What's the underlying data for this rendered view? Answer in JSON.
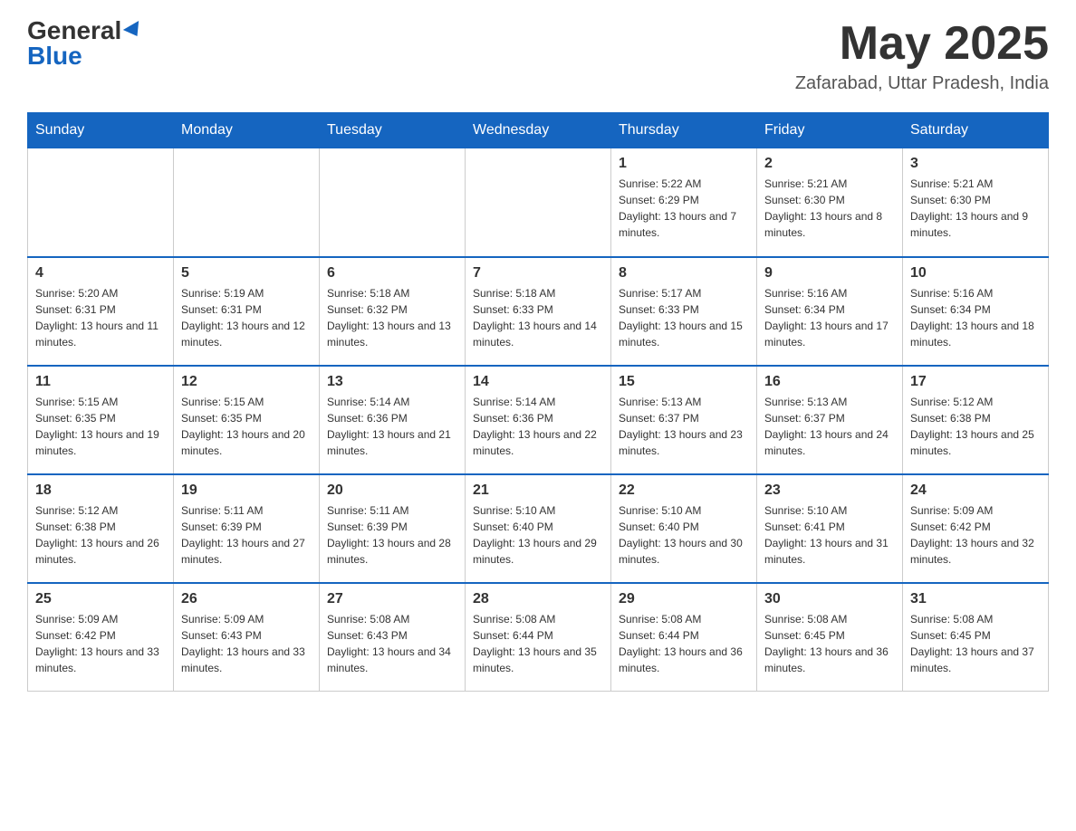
{
  "header": {
    "logo": {
      "general": "General",
      "blue": "Blue"
    },
    "title": "May 2025",
    "subtitle": "Zafarabad, Uttar Pradesh, India"
  },
  "days_of_week": [
    "Sunday",
    "Monday",
    "Tuesday",
    "Wednesday",
    "Thursday",
    "Friday",
    "Saturday"
  ],
  "weeks": [
    {
      "days": [
        {
          "number": "",
          "info": ""
        },
        {
          "number": "",
          "info": ""
        },
        {
          "number": "",
          "info": ""
        },
        {
          "number": "",
          "info": ""
        },
        {
          "number": "1",
          "info": "Sunrise: 5:22 AM\nSunset: 6:29 PM\nDaylight: 13 hours and 7 minutes."
        },
        {
          "number": "2",
          "info": "Sunrise: 5:21 AM\nSunset: 6:30 PM\nDaylight: 13 hours and 8 minutes."
        },
        {
          "number": "3",
          "info": "Sunrise: 5:21 AM\nSunset: 6:30 PM\nDaylight: 13 hours and 9 minutes."
        }
      ]
    },
    {
      "days": [
        {
          "number": "4",
          "info": "Sunrise: 5:20 AM\nSunset: 6:31 PM\nDaylight: 13 hours and 11 minutes."
        },
        {
          "number": "5",
          "info": "Sunrise: 5:19 AM\nSunset: 6:31 PM\nDaylight: 13 hours and 12 minutes."
        },
        {
          "number": "6",
          "info": "Sunrise: 5:18 AM\nSunset: 6:32 PM\nDaylight: 13 hours and 13 minutes."
        },
        {
          "number": "7",
          "info": "Sunrise: 5:18 AM\nSunset: 6:33 PM\nDaylight: 13 hours and 14 minutes."
        },
        {
          "number": "8",
          "info": "Sunrise: 5:17 AM\nSunset: 6:33 PM\nDaylight: 13 hours and 15 minutes."
        },
        {
          "number": "9",
          "info": "Sunrise: 5:16 AM\nSunset: 6:34 PM\nDaylight: 13 hours and 17 minutes."
        },
        {
          "number": "10",
          "info": "Sunrise: 5:16 AM\nSunset: 6:34 PM\nDaylight: 13 hours and 18 minutes."
        }
      ]
    },
    {
      "days": [
        {
          "number": "11",
          "info": "Sunrise: 5:15 AM\nSunset: 6:35 PM\nDaylight: 13 hours and 19 minutes."
        },
        {
          "number": "12",
          "info": "Sunrise: 5:15 AM\nSunset: 6:35 PM\nDaylight: 13 hours and 20 minutes."
        },
        {
          "number": "13",
          "info": "Sunrise: 5:14 AM\nSunset: 6:36 PM\nDaylight: 13 hours and 21 minutes."
        },
        {
          "number": "14",
          "info": "Sunrise: 5:14 AM\nSunset: 6:36 PM\nDaylight: 13 hours and 22 minutes."
        },
        {
          "number": "15",
          "info": "Sunrise: 5:13 AM\nSunset: 6:37 PM\nDaylight: 13 hours and 23 minutes."
        },
        {
          "number": "16",
          "info": "Sunrise: 5:13 AM\nSunset: 6:37 PM\nDaylight: 13 hours and 24 minutes."
        },
        {
          "number": "17",
          "info": "Sunrise: 5:12 AM\nSunset: 6:38 PM\nDaylight: 13 hours and 25 minutes."
        }
      ]
    },
    {
      "days": [
        {
          "number": "18",
          "info": "Sunrise: 5:12 AM\nSunset: 6:38 PM\nDaylight: 13 hours and 26 minutes."
        },
        {
          "number": "19",
          "info": "Sunrise: 5:11 AM\nSunset: 6:39 PM\nDaylight: 13 hours and 27 minutes."
        },
        {
          "number": "20",
          "info": "Sunrise: 5:11 AM\nSunset: 6:39 PM\nDaylight: 13 hours and 28 minutes."
        },
        {
          "number": "21",
          "info": "Sunrise: 5:10 AM\nSunset: 6:40 PM\nDaylight: 13 hours and 29 minutes."
        },
        {
          "number": "22",
          "info": "Sunrise: 5:10 AM\nSunset: 6:40 PM\nDaylight: 13 hours and 30 minutes."
        },
        {
          "number": "23",
          "info": "Sunrise: 5:10 AM\nSunset: 6:41 PM\nDaylight: 13 hours and 31 minutes."
        },
        {
          "number": "24",
          "info": "Sunrise: 5:09 AM\nSunset: 6:42 PM\nDaylight: 13 hours and 32 minutes."
        }
      ]
    },
    {
      "days": [
        {
          "number": "25",
          "info": "Sunrise: 5:09 AM\nSunset: 6:42 PM\nDaylight: 13 hours and 33 minutes."
        },
        {
          "number": "26",
          "info": "Sunrise: 5:09 AM\nSunset: 6:43 PM\nDaylight: 13 hours and 33 minutes."
        },
        {
          "number": "27",
          "info": "Sunrise: 5:08 AM\nSunset: 6:43 PM\nDaylight: 13 hours and 34 minutes."
        },
        {
          "number": "28",
          "info": "Sunrise: 5:08 AM\nSunset: 6:44 PM\nDaylight: 13 hours and 35 minutes."
        },
        {
          "number": "29",
          "info": "Sunrise: 5:08 AM\nSunset: 6:44 PM\nDaylight: 13 hours and 36 minutes."
        },
        {
          "number": "30",
          "info": "Sunrise: 5:08 AM\nSunset: 6:45 PM\nDaylight: 13 hours and 36 minutes."
        },
        {
          "number": "31",
          "info": "Sunrise: 5:08 AM\nSunset: 6:45 PM\nDaylight: 13 hours and 37 minutes."
        }
      ]
    }
  ]
}
